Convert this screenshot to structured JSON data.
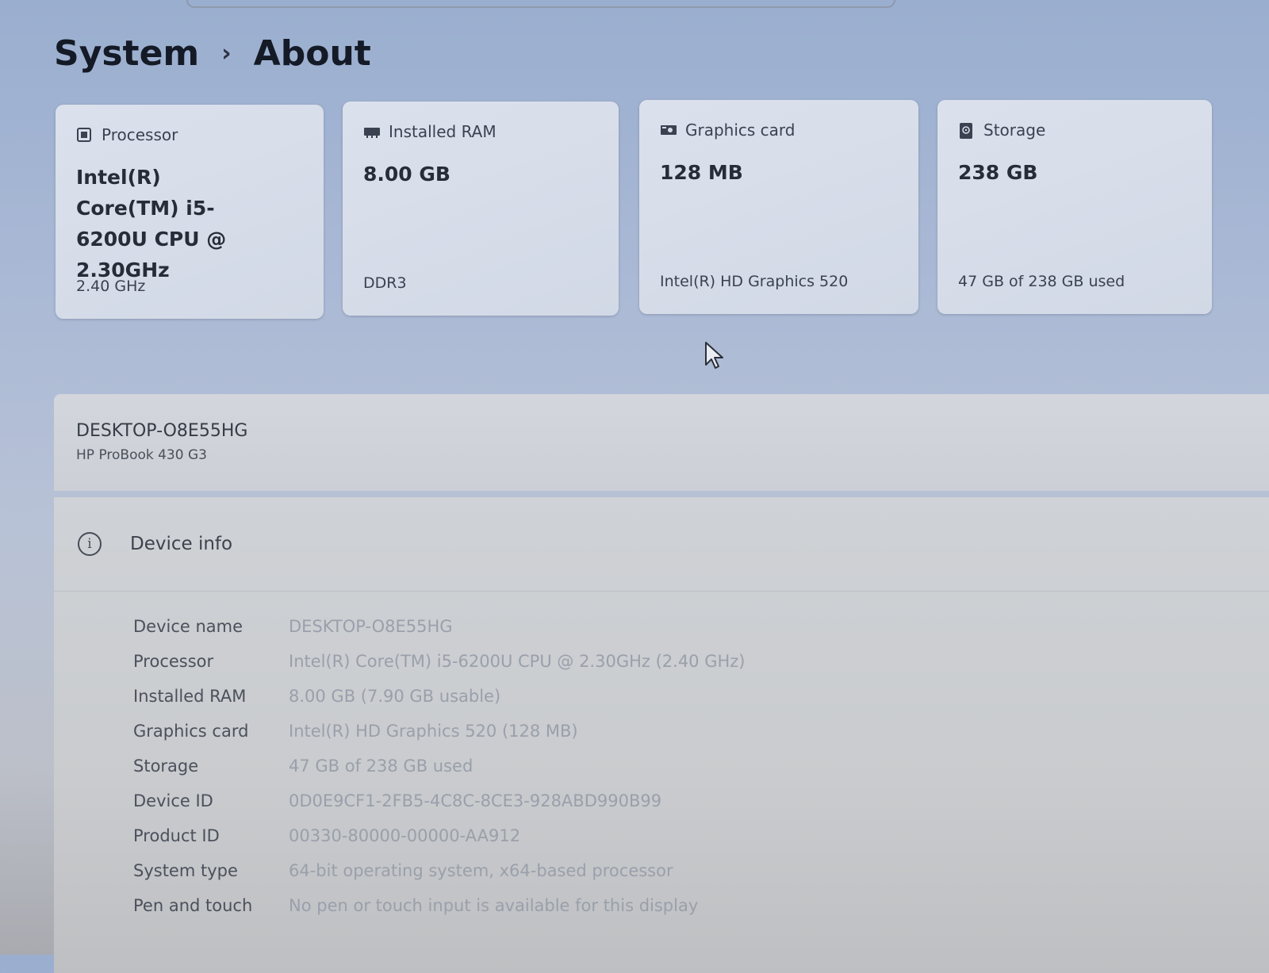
{
  "breadcrumb": {
    "parent": "System",
    "separator": "›",
    "current": "About"
  },
  "cards": [
    {
      "label": "Processor",
      "icon": "processor-icon",
      "value": "Intel(R) Core(TM) i5-6200U CPU @ 2.30GHz",
      "sub": "2.40 GHz"
    },
    {
      "label": "Installed RAM",
      "icon": "ram-icon",
      "value": "8.00 GB",
      "sub": "DDR3"
    },
    {
      "label": "Graphics card",
      "icon": "graphics-card-icon",
      "value": "128 MB",
      "sub": "Intel(R) HD Graphics 520"
    },
    {
      "label": "Storage",
      "icon": "storage-icon",
      "value": "238 GB",
      "sub": "47 GB of 238 GB used"
    }
  ],
  "device_summary": {
    "name": "DESKTOP-O8E55HG",
    "model": "HP ProBook 430 G3"
  },
  "device_info": {
    "title": "Device info",
    "icon": "info-icon",
    "rows": [
      {
        "label": "Device name",
        "value": "DESKTOP-O8E55HG"
      },
      {
        "label": "Processor",
        "value": "Intel(R) Core(TM) i5-6200U CPU @ 2.30GHz (2.40 GHz)"
      },
      {
        "label": "Installed RAM",
        "value": "8.00 GB (7.90 GB usable)"
      },
      {
        "label": "Graphics card",
        "value": "Intel(R) HD Graphics 520 (128 MB)"
      },
      {
        "label": "Storage",
        "value": "47 GB of 238 GB used"
      },
      {
        "label": "Device ID",
        "value": "0D0E9CF1-2FB5-4C8C-8CE3-928ABD990B99"
      },
      {
        "label": "Product ID",
        "value": "00330-80000-00000-AA912"
      },
      {
        "label": "System type",
        "value": "64-bit operating system, x64-based processor"
      },
      {
        "label": "Pen and touch",
        "value": "No pen or touch input is available for this display"
      }
    ]
  },
  "colors": {
    "background_top": "#9aaecf",
    "card_bg": "#d6dce8",
    "panel_bg": "#d0d3d8",
    "value_text_faded": "#9aa0ab"
  }
}
